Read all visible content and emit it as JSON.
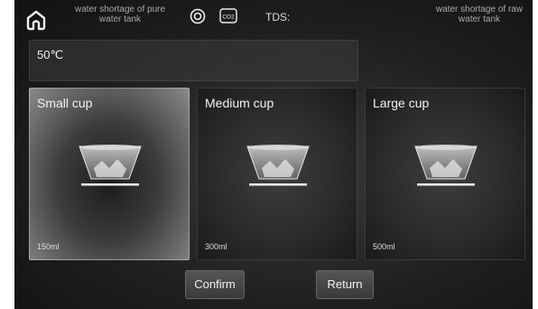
{
  "status": {
    "pure_tank_warning": "water shortage of pure water tank",
    "raw_tank_warning": "water shortage of raw water tank",
    "tds_label": "TDS:",
    "co2_label": "CO2",
    "uv_icon": "uv-sterilize-icon",
    "home_icon": "home-icon"
  },
  "temperature": {
    "value": "50℃"
  },
  "cups": [
    {
      "label": "Small cup",
      "volume": "150ml",
      "selected": true
    },
    {
      "label": "Medium cup",
      "volume": "300ml",
      "selected": false
    },
    {
      "label": "Large cup",
      "volume": "500ml",
      "selected": false
    }
  ],
  "actions": {
    "confirm": "Confirm",
    "return": "Return"
  },
  "colors": {
    "background": "#1e1e1e",
    "text": "#e8e8e8",
    "muted": "#aaaaaa"
  }
}
